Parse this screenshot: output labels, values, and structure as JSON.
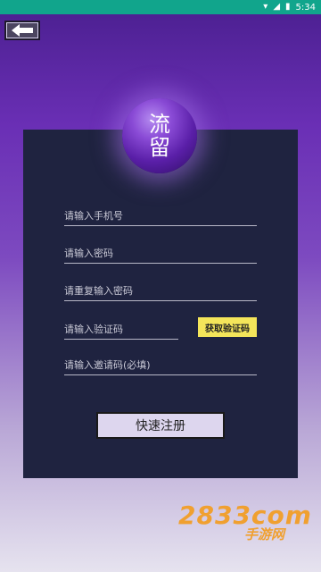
{
  "status_bar": {
    "time": "5:34"
  },
  "logo": {
    "line1": "流",
    "line2": "留"
  },
  "form": {
    "phone_placeholder": "请输入手机号",
    "password_placeholder": "请输入密码",
    "repeat_password_placeholder": "请重复输入密码",
    "code_placeholder": "请输入验证码",
    "invite_placeholder": "请输入邀请码(必填)",
    "get_code_label": "获取验证码",
    "register_label": "快速注册"
  },
  "watermark": {
    "top": "2833com",
    "bottom": "手游网"
  },
  "colors": {
    "status_bar": "#11a58c",
    "panel": "#1f2340",
    "code_button": "#f4e55a"
  }
}
